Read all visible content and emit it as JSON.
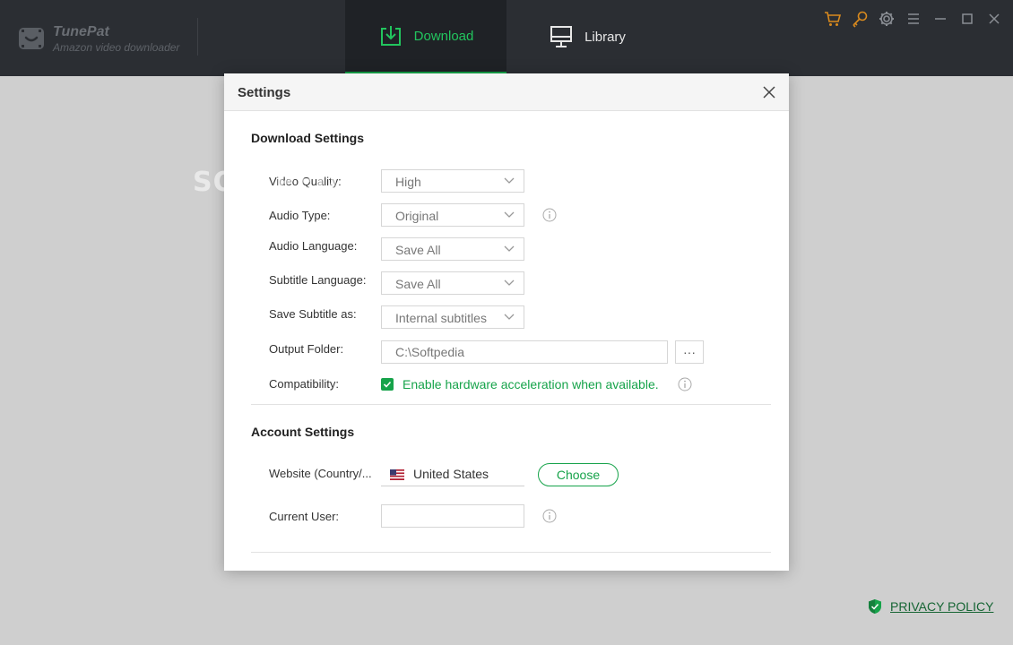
{
  "app": {
    "name": "TunePat",
    "subtitle": "Amazon video downloader"
  },
  "tabs": [
    {
      "label": "Download",
      "icon": "download-icon",
      "active": true
    },
    {
      "label": "Library",
      "icon": "monitor-icon",
      "active": false
    }
  ],
  "top_icons": [
    "cart-icon",
    "key-icon",
    "gear-icon",
    "menu-icon",
    "minimize-icon",
    "maximize-icon",
    "close-icon"
  ],
  "watermark": "SOFTPEDIA",
  "dialog": {
    "title": "Settings",
    "download_settings": {
      "title": "Download Settings",
      "video_quality": {
        "label": "Video Quality:",
        "value": "High"
      },
      "audio_type": {
        "label": "Audio Type:",
        "value": "Original"
      },
      "audio_language": {
        "label": "Audio Language:",
        "value": "Save All"
      },
      "subtitle_language": {
        "label": "Subtitle Language:",
        "value": "Save All"
      },
      "save_subtitle_as": {
        "label": "Save Subtitle as:",
        "value": "Internal subtitles"
      },
      "output_folder": {
        "label": "Output Folder:",
        "value": "C:\\Softpedia",
        "browse_label": "···"
      },
      "compatibility": {
        "label": "Compatibility:",
        "checkbox_label": "Enable hardware acceleration when available.",
        "checked": true
      }
    },
    "account_settings": {
      "title": "Account Settings",
      "website": {
        "label": "Website (Country/...",
        "country": "United States",
        "choose_label": "Choose"
      },
      "current_user": {
        "label": "Current User:",
        "value": ""
      }
    }
  },
  "footer": {
    "privacy_label": "PRIVACY POLICY"
  },
  "colors": {
    "titlebar": "#2b2e33",
    "accent_green": "#16a34a",
    "top_icon_orange": "#d98a1e",
    "overlay": "#cfcfcf"
  }
}
